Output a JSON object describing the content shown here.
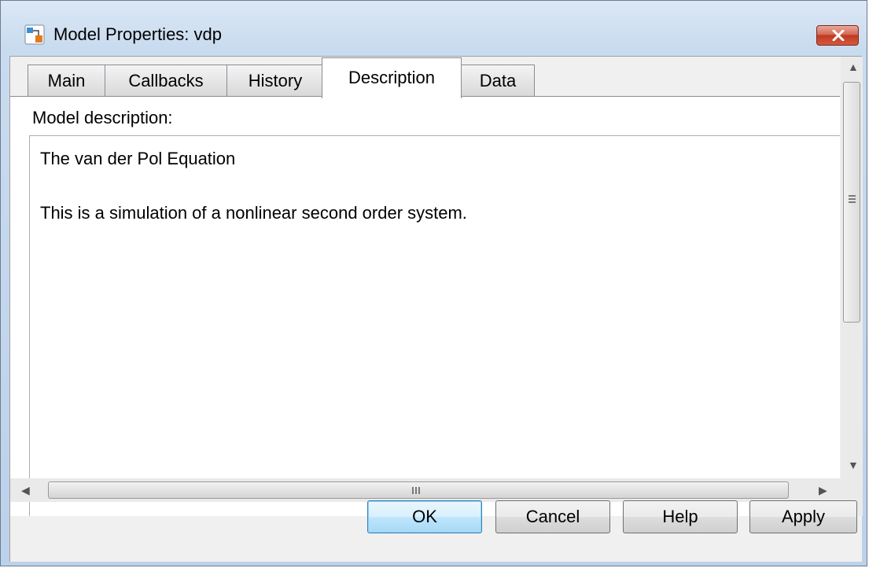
{
  "window": {
    "title": "Model Properties: vdp",
    "icon": "simulink-model-icon"
  },
  "tabs": [
    {
      "label": "Main",
      "active": false
    },
    {
      "label": "Callbacks",
      "active": false
    },
    {
      "label": "History",
      "active": false
    },
    {
      "label": "Description",
      "active": true
    },
    {
      "label": "Data",
      "active": false
    }
  ],
  "panel": {
    "label": "Model description:",
    "description_lines": [
      "The van der Pol Equation",
      "This is a simulation of a nonlinear second order system."
    ]
  },
  "scrollbar": {
    "h_grip": "III"
  },
  "buttons": {
    "ok": "OK",
    "cancel": "Cancel",
    "help": "Help",
    "apply": "Apply"
  }
}
